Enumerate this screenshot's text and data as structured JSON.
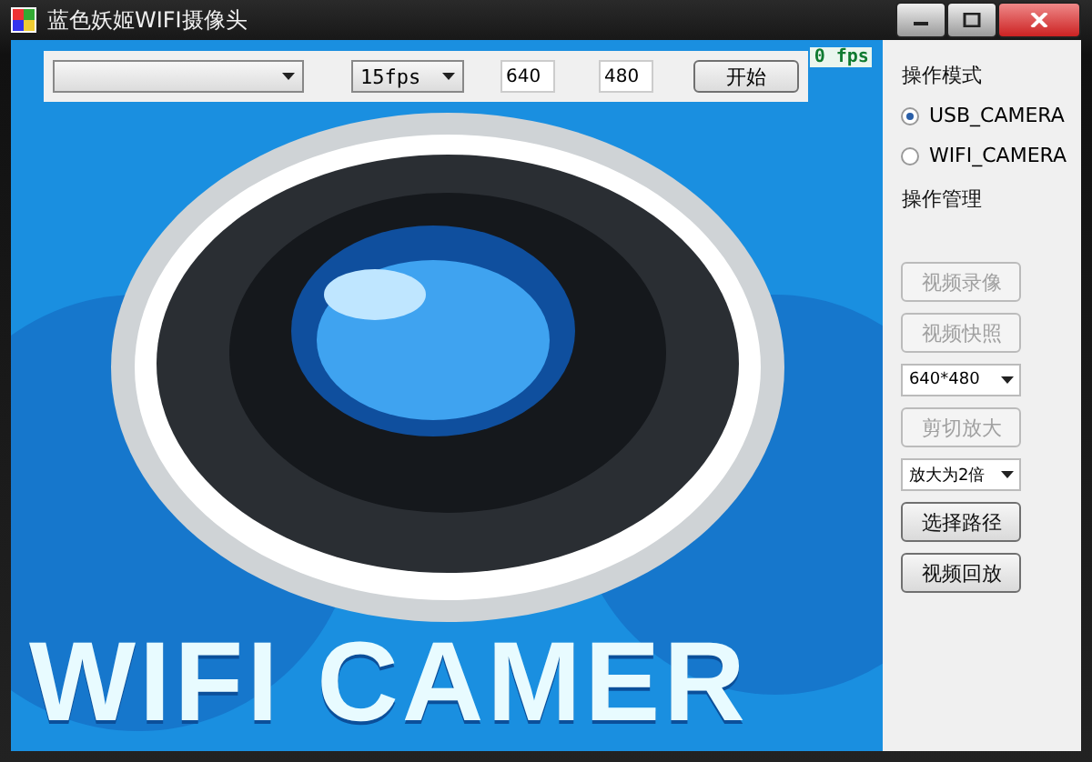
{
  "window": {
    "title": "蓝色妖姬WIFI摄像头"
  },
  "toolbar": {
    "fps_select": {
      "value": "15fps"
    },
    "width_field": {
      "value": "640"
    },
    "height_field": {
      "value": "480"
    },
    "start_button": {
      "label": "开始"
    }
  },
  "fps_readout": "0 fps",
  "preview": {
    "banner_text": "WIFI CAMER"
  },
  "mode_group": {
    "title": "操作模式",
    "options": [
      {
        "label": "USB_CAMERA",
        "selected": true
      },
      {
        "label": "WIFI_CAMERA",
        "selected": false
      }
    ]
  },
  "manage_group": {
    "title": "操作管理",
    "controls": [
      {
        "kind": "button",
        "label": "视频录像",
        "disabled": true
      },
      {
        "kind": "button",
        "label": "视频快照",
        "disabled": true
      },
      {
        "kind": "dropdown",
        "label": "640*480"
      },
      {
        "kind": "button",
        "label": "剪切放大",
        "disabled": true
      },
      {
        "kind": "dropdown",
        "label": "放大为2倍"
      },
      {
        "kind": "button",
        "label": "选择路径",
        "disabled": false
      },
      {
        "kind": "button",
        "label": "视频回放",
        "disabled": false
      }
    ]
  }
}
